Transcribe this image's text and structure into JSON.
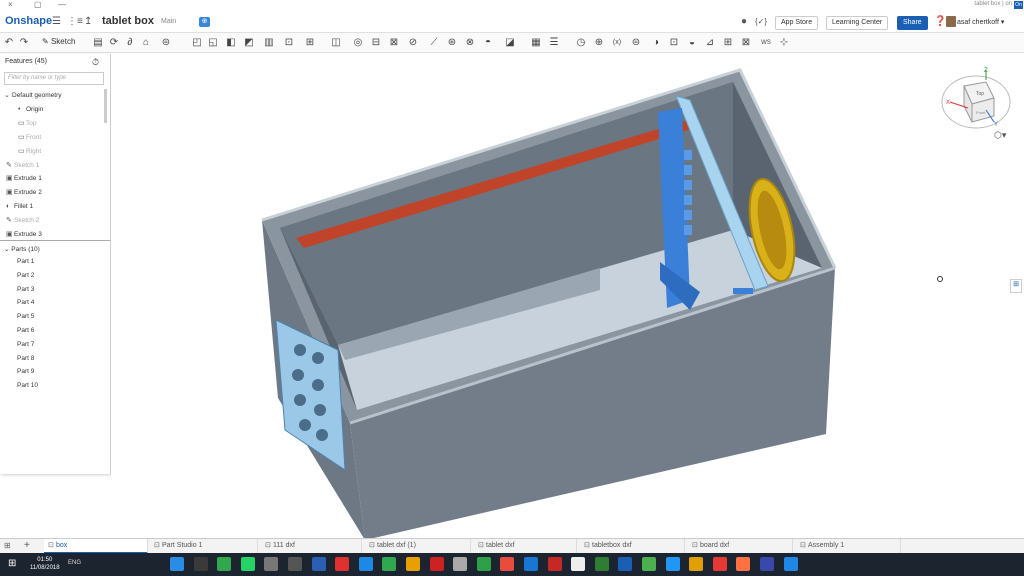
{
  "browser": {
    "tab_info": "tablet box | on",
    "tab_icon": "On",
    "win_close": "×",
    "win_restore": "▢",
    "win_min": "—"
  },
  "topbar": {
    "logo": "Onshape",
    "document_title": "tablet box",
    "branch": "Main",
    "app_store": "App Store",
    "learning_center": "Learning Center",
    "share": "Share",
    "user": "asaf chertkoff ▾"
  },
  "toolbar": {
    "sketch": "Sketch"
  },
  "features": {
    "title": "Features (45)",
    "filter_placeholder": "Filter by name or type",
    "items": [
      {
        "label": "Default geometry",
        "icon": "⌄",
        "dim": false,
        "indent": 4
      },
      {
        "label": "Origin",
        "icon": "•",
        "dim": false,
        "indent": 18
      },
      {
        "label": "Top",
        "icon": "▭",
        "dim": true,
        "indent": 18
      },
      {
        "label": "Front",
        "icon": "▭",
        "dim": true,
        "indent": 18
      },
      {
        "label": "Right",
        "icon": "▭",
        "dim": true,
        "indent": 18
      },
      {
        "label": "Sketch 1",
        "icon": "✎",
        "dim": true,
        "indent": 6
      },
      {
        "label": "Extrude 1",
        "icon": "▣",
        "dim": false,
        "indent": 6
      },
      {
        "label": "Extrude 2",
        "icon": "▣",
        "dim": false,
        "indent": 6
      },
      {
        "label": "Fillet 1",
        "icon": "◐",
        "dim": false,
        "indent": 6
      },
      {
        "label": "Sketch 2",
        "icon": "✎",
        "dim": true,
        "indent": 6
      },
      {
        "label": "Extrude 3",
        "icon": "▣",
        "dim": false,
        "indent": 6
      }
    ],
    "parts_title": "Parts (10)",
    "parts": [
      "Part 1",
      "Part 2",
      "Part 3",
      "Part 4",
      "Part 5",
      "Part 6",
      "Part 7",
      "Part 8",
      "Part 9",
      "Part 10"
    ]
  },
  "viewcube": {
    "top": "Top",
    "front": "Front",
    "x": "X",
    "y": "Y",
    "z": "Z"
  },
  "tabs": [
    {
      "label": "box",
      "active": true
    },
    {
      "label": "Part Studio 1",
      "active": false
    },
    {
      "label": "111 dxf",
      "active": false
    },
    {
      "label": "tablet dxf (1)",
      "active": false
    },
    {
      "label": "tablet dxf",
      "active": false
    },
    {
      "label": "tabletbox dxf",
      "active": false
    },
    {
      "label": "board dxf",
      "active": false
    },
    {
      "label": "Assembly 1",
      "active": false
    }
  ],
  "taskbar": {
    "time": "01:50",
    "date": "11/08/2018",
    "lang": "ENG"
  },
  "colors": {
    "brand": "#1a5fb4",
    "box": "#6b7480",
    "red_part": "#c0442a",
    "gold_part": "#d9b21a",
    "blue_part": "#3a7fd8"
  }
}
